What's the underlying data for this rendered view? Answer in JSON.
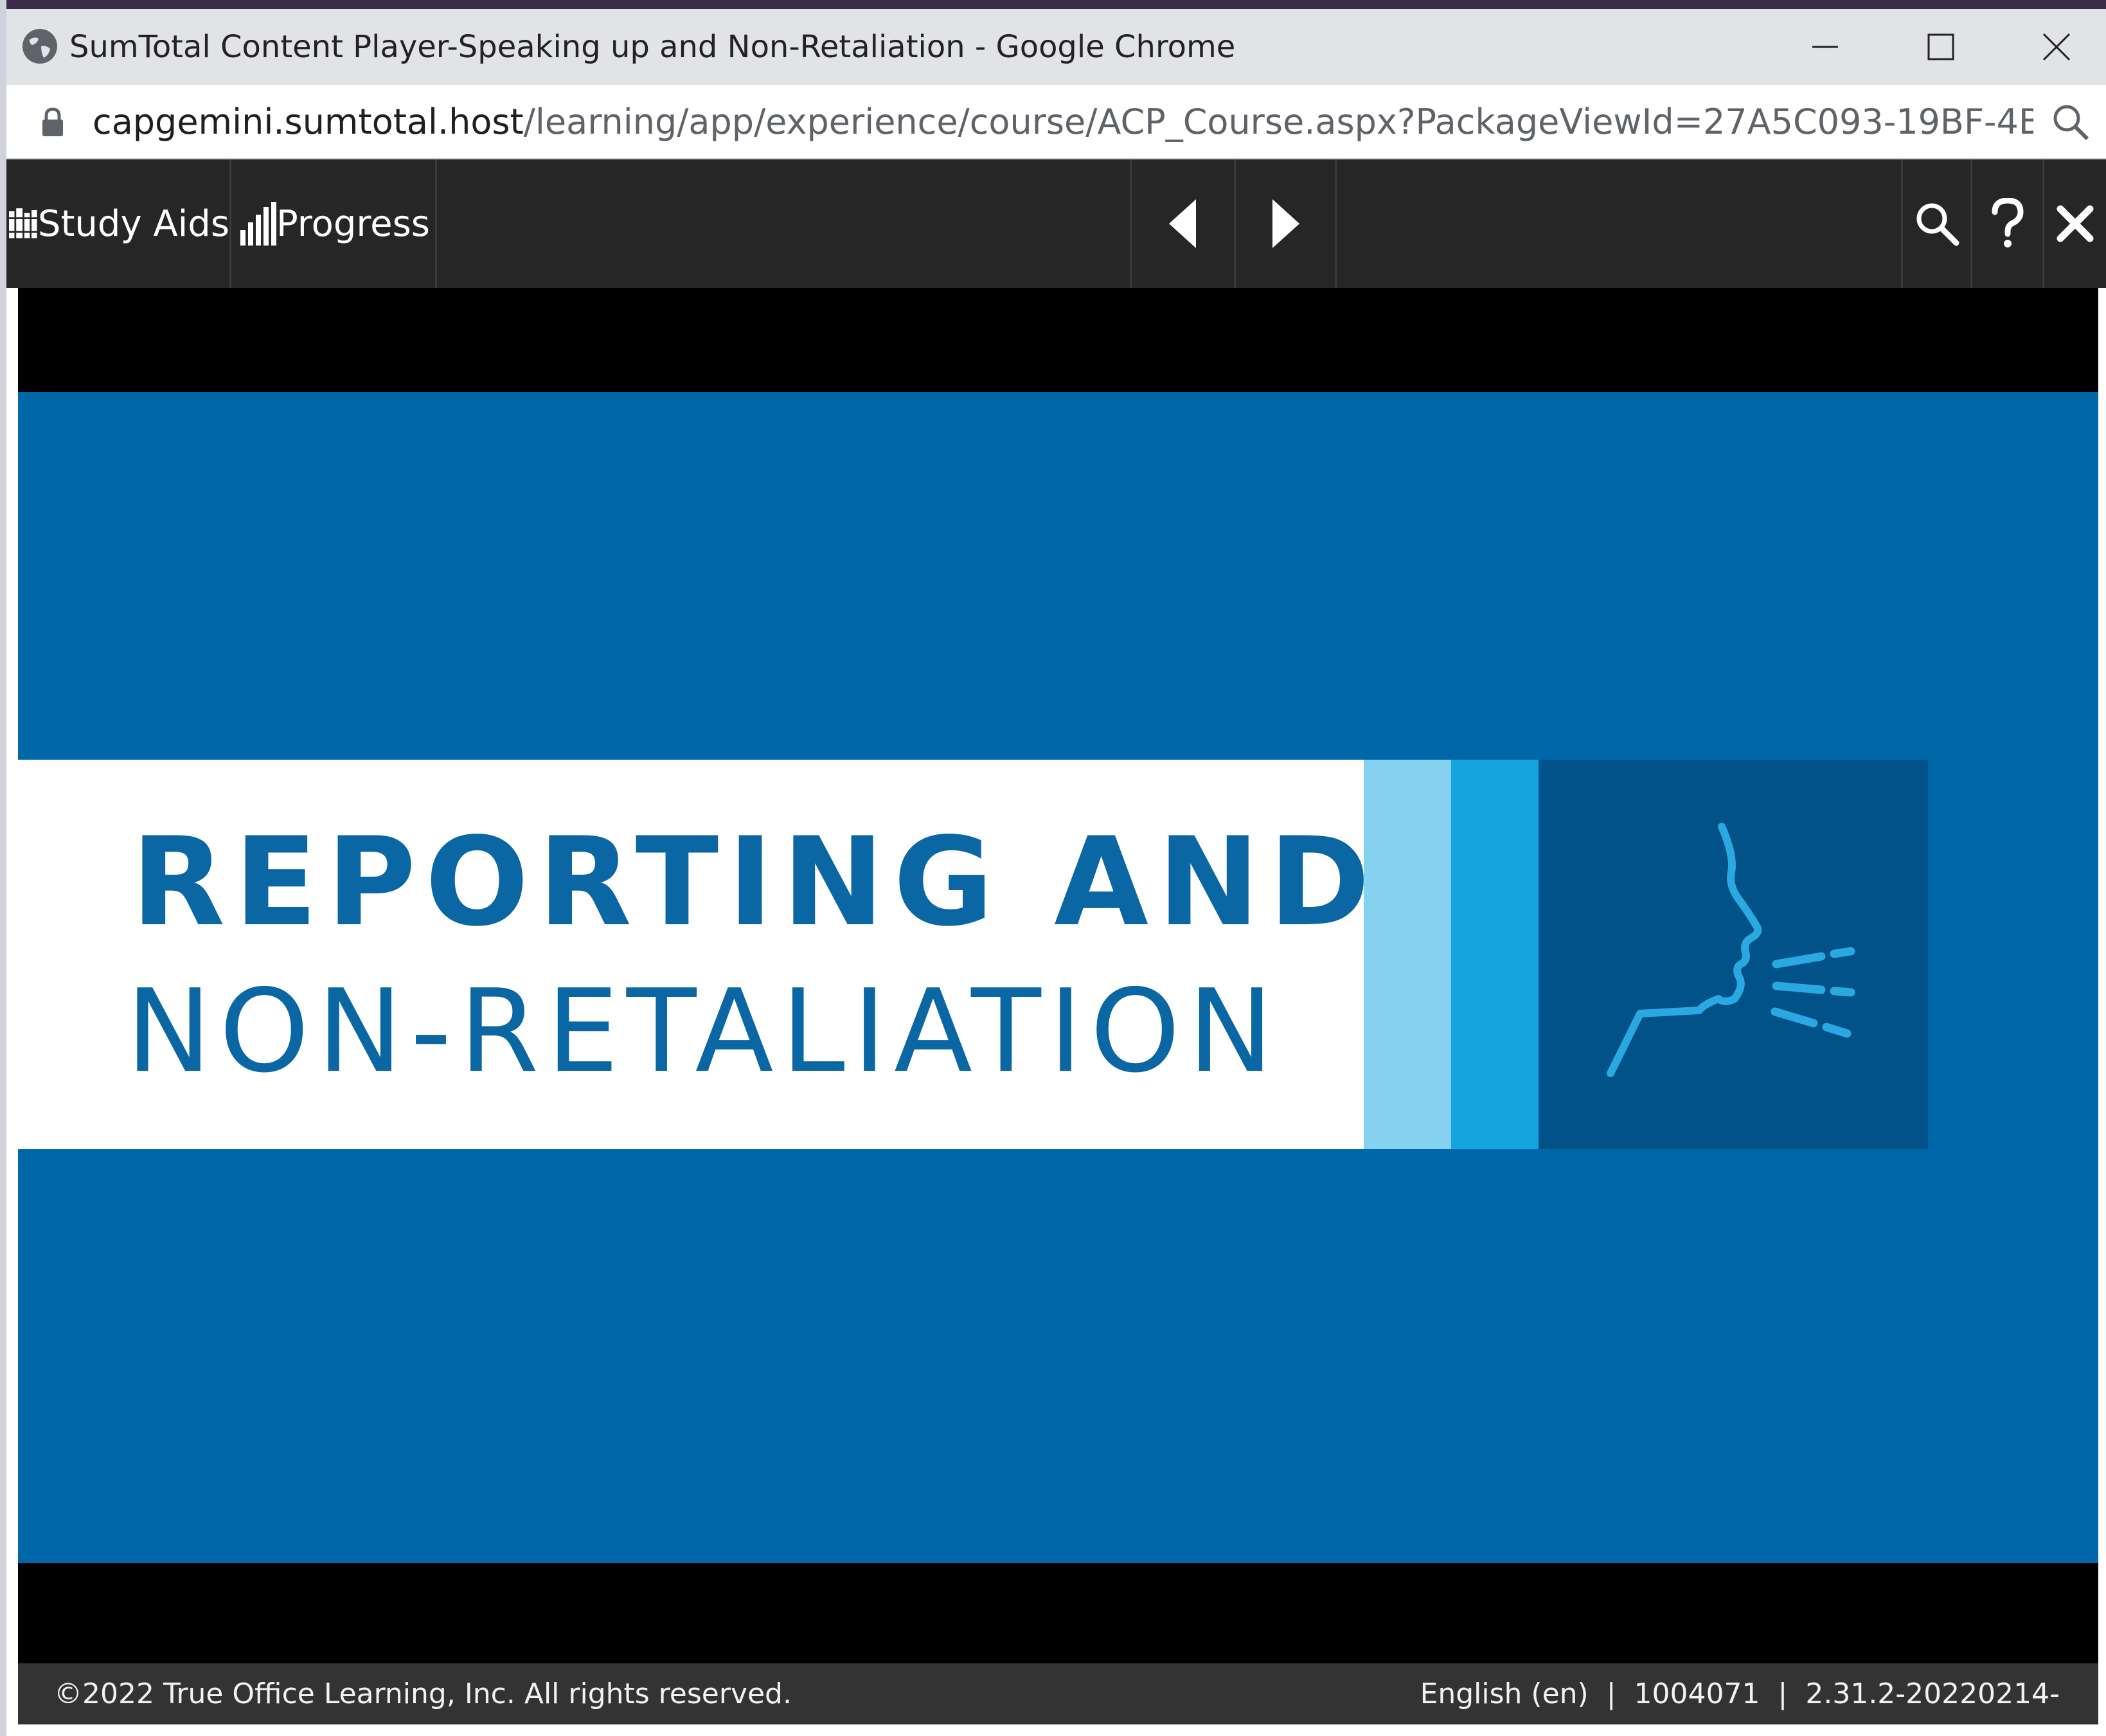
{
  "window": {
    "title": "SumTotal Content Player-Speaking up and Non-Retaliation - Google Chrome",
    "minimize_icon": "minimize-icon",
    "maximize_icon": "maximize-icon",
    "close_icon": "close-icon"
  },
  "address_bar": {
    "host": "capgemini.sumtotal.host",
    "path": "/learning/app/experience/course/ACP_Course.aspx?PackageViewId=27A5C093-19BF-4B0D-B51..."
  },
  "toolbar": {
    "study_aids_label": "Study Aids",
    "progress_label": "Progress"
  },
  "slide": {
    "title_line1": "REPORTING AND",
    "title_line2": "NON-RETALIATION",
    "colors": {
      "background": "#0068a8",
      "title": "#0a67a4",
      "stripe_light": "#86d1f0",
      "stripe_mid": "#14a5de",
      "icon_box": "#005289"
    }
  },
  "footer": {
    "copyright": "©2022 True Office Learning, Inc. All rights reserved.",
    "language": "English (en)",
    "id": "1004071",
    "version": "2.31.2-20220214-"
  }
}
